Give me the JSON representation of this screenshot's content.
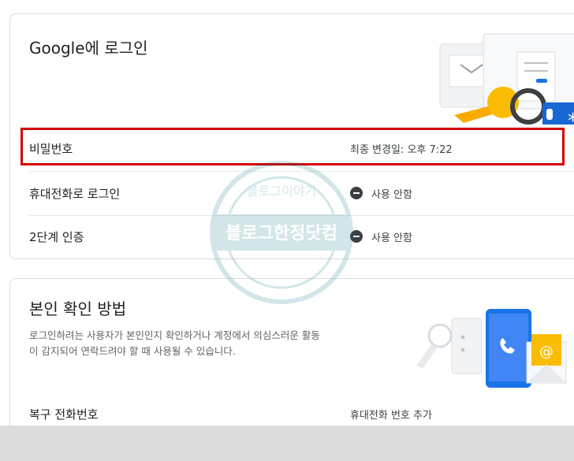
{
  "signin_card": {
    "title": "Google에 로그인",
    "rows": [
      {
        "label": "비밀번호",
        "value": "최종 변경일: 오후 7:22"
      },
      {
        "label": "휴대전화로 로그인",
        "value": "사용 안함",
        "icon": "minus-circle-icon"
      },
      {
        "label": "2단계 인증",
        "value": "사용 안함",
        "icon": "minus-circle-icon"
      }
    ]
  },
  "verify_card": {
    "title": "본인 확인 방법",
    "description_lines": [
      "로그인하려는 사용자가 본인인지 확인하거나 계정에서 의심스러운 활동",
      "이 감지되어 연락드려야 할 때 사용될 수 있습니다."
    ],
    "rows": [
      {
        "label": "복구 전화번호",
        "value": "휴대전화 번호 추가"
      }
    ]
  },
  "watermark": {
    "top_text": "블로그이야기",
    "main_text": "블로그한정닷컴"
  },
  "colors": {
    "highlight": "#d40000",
    "accent_blue": "#1a73e8",
    "key_yellow": "#f9ab00"
  }
}
